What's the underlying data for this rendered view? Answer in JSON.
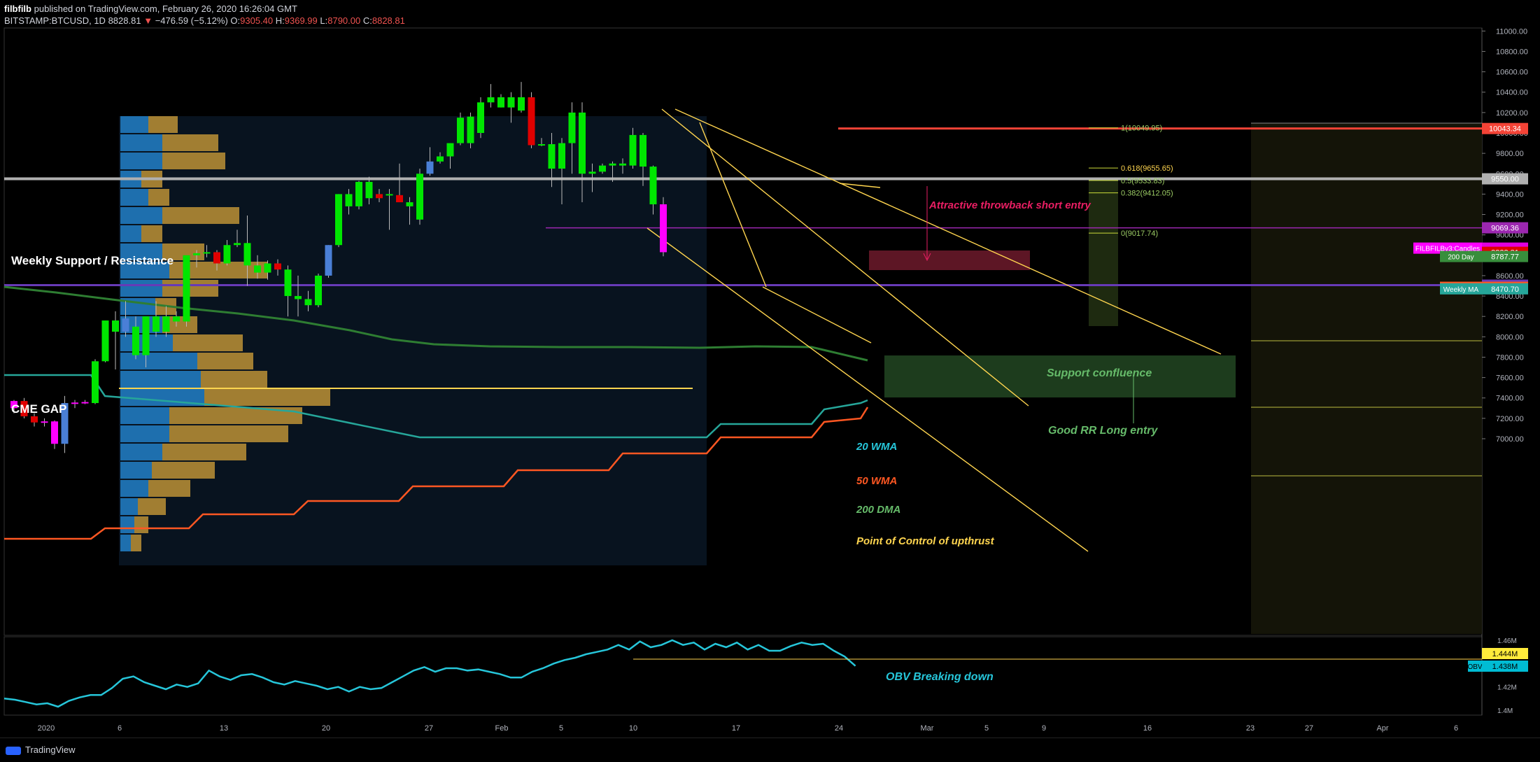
{
  "header": {
    "author": "filbfilb",
    "published": "published on TradingView.com, February 26, 2020 16:26:04 GMT",
    "symbol": "BITSTAMP:BTCUSD, 1D",
    "last": "8828.81",
    "change": "−476.59 (−5.12%)",
    "open_label": "O:",
    "open": "9305.40",
    "high_label": "H:",
    "high": "9369.99",
    "low_label": "L:",
    "low": "8790.00",
    "close_label": "C:",
    "close": "8828.81"
  },
  "footer": {
    "brand": "TradingView"
  },
  "colors": {
    "up": "#00e600",
    "down": "#e00000",
    "blue_candle": "#4a7fd6",
    "magenta_candle": "#ff00ff",
    "teal_line": "#26a69a",
    "orange_line": "#ff5722",
    "green_ma": "#2e7d32",
    "purple_line": "#673ab7",
    "white_line": "#b0b0b0",
    "yellow": "#ffd54f",
    "red_line": "#f44336",
    "obv": "#26c6da"
  },
  "chart_data": {
    "type": "candlestick",
    "y_axis": {
      "range": [
        6900,
        11100
      ],
      "ticks": [
        "11000.00",
        "10800.00",
        "10600.00",
        "10400.00",
        "10200.00",
        "10000.00",
        "9800.00",
        "9600.00",
        "9400.00",
        "9200.00",
        "9000.00",
        "8800.00",
        "8600.00",
        "8400.00",
        "8200.00",
        "8000.00",
        "7800.00",
        "7600.00",
        "7400.00",
        "7200.00",
        "7000.00"
      ]
    },
    "x_axis": {
      "ticks": [
        "2020",
        "6",
        "13",
        "20",
        "27",
        "Feb",
        "5",
        "10",
        "17",
        "24",
        "Mar",
        "5",
        "9",
        "16",
        "23",
        "27",
        "Apr",
        "6"
      ]
    },
    "price_labels": [
      {
        "text": "10043.34",
        "value": 10043.34,
        "color": "#f44336"
      },
      {
        "text": "9550.00",
        "value": 9550,
        "color": "#b0b0b0"
      },
      {
        "text": "9069.36",
        "value": 9069.36,
        "color": "#9c27b0"
      },
      {
        "text": "FILBFILBv3:Candles",
        "value": 8870,
        "color": "#ff00ff"
      },
      {
        "text": "8828.81",
        "value": 8828.81,
        "color": "#e00000"
      },
      {
        "text": "200 Day",
        "value": 8787.77,
        "color": "#388e3c",
        "value_text": "8787.77"
      },
      {
        "text": "8506.61",
        "value": 8506.61,
        "color": "#673ab7"
      },
      {
        "text": "Weekly MA",
        "value": 8485.73,
        "color": "#ff5722",
        "value_text": "8485.73"
      },
      {
        "text": "Weekly MA",
        "value": 8470.7,
        "color": "#26a69a",
        "value_text": "8470.70"
      }
    ],
    "fib_levels": [
      {
        "text": "1(10049.95)",
        "value": 10049.95
      },
      {
        "text": "0.618(9655.65)",
        "value": 9655.65
      },
      {
        "text": "0.5(9533.83)",
        "value": 9533.83
      },
      {
        "text": "0.382(9412.05)",
        "value": 9412.05
      },
      {
        "text": "0(9017.74)",
        "value": 9017.74
      }
    ],
    "annotations": [
      {
        "text": "Weekly Support / Resistance"
      },
      {
        "text": "CME GAP"
      },
      {
        "text": "Attractive throwback short entry"
      },
      {
        "text": "Support confluence"
      },
      {
        "text": "Good RR Long entry"
      },
      {
        "text": "20 WMA"
      },
      {
        "text": "50 WMA"
      },
      {
        "text": "200 DMA"
      },
      {
        "text": "Point of Control of upthrust"
      },
      {
        "text": "OBV Breaking down"
      }
    ],
    "candles": [
      {
        "o": 7300,
        "h": 7380,
        "l": 7250,
        "c": 7370
      },
      {
        "o": 7370,
        "h": 7400,
        "l": 7200,
        "c": 7220
      },
      {
        "o": 7220,
        "h": 7250,
        "l": 7120,
        "c": 7160
      },
      {
        "o": 7160,
        "h": 7200,
        "l": 7120,
        "c": 7170
      },
      {
        "o": 7170,
        "h": 7180,
        "l": 6900,
        "c": 6950
      },
      {
        "o": 6950,
        "h": 7420,
        "l": 6860,
        "c": 7350
      },
      {
        "o": 7350,
        "h": 7380,
        "l": 7300,
        "c": 7355
      },
      {
        "o": 7355,
        "h": 7380,
        "l": 7340,
        "c": 7360
      },
      {
        "o": 7350,
        "h": 7780,
        "l": 7340,
        "c": 7760
      },
      {
        "o": 7760,
        "h": 8100,
        "l": 7750,
        "c": 8160
      },
      {
        "o": 8160,
        "h": 8250,
        "l": 7680,
        "c": 8050
      },
      {
        "o": 8050,
        "h": 8350,
        "l": 8000,
        "c": 8180
      },
      {
        "o": 8100,
        "h": 8200,
        "l": 7780,
        "c": 7820
      },
      {
        "o": 7820,
        "h": 8150,
        "l": 7700,
        "c": 8200
      },
      {
        "o": 8200,
        "h": 8350,
        "l": 8000,
        "c": 8050
      },
      {
        "o": 8050,
        "h": 8300,
        "l": 8000,
        "c": 8200
      },
      {
        "o": 8200,
        "h": 8250,
        "l": 8100,
        "c": 8150
      },
      {
        "o": 8150,
        "h": 8650,
        "l": 8100,
        "c": 8800
      },
      {
        "o": 8800,
        "h": 8850,
        "l": 8680,
        "c": 8820
      },
      {
        "o": 8820,
        "h": 8900,
        "l": 8780,
        "c": 8830
      },
      {
        "o": 8830,
        "h": 8850,
        "l": 8650,
        "c": 8720
      },
      {
        "o": 8720,
        "h": 8950,
        "l": 8700,
        "c": 8900
      },
      {
        "o": 8900,
        "h": 9050,
        "l": 8880,
        "c": 8920
      },
      {
        "o": 8920,
        "h": 9190,
        "l": 8500,
        "c": 8700
      },
      {
        "o": 8700,
        "h": 8800,
        "l": 8570,
        "c": 8630
      },
      {
        "o": 8630,
        "h": 8750,
        "l": 8560,
        "c": 8720
      },
      {
        "o": 8720,
        "h": 8760,
        "l": 8600,
        "c": 8660
      },
      {
        "o": 8660,
        "h": 8700,
        "l": 8200,
        "c": 8400
      },
      {
        "o": 8400,
        "h": 8600,
        "l": 8200,
        "c": 8370
      },
      {
        "o": 8370,
        "h": 8450,
        "l": 8250,
        "c": 8310
      },
      {
        "o": 8310,
        "h": 8620,
        "l": 8290,
        "c": 8600
      },
      {
        "o": 8600,
        "h": 8900,
        "l": 8580,
        "c": 8900
      },
      {
        "o": 8900,
        "h": 9400,
        "l": 8880,
        "c": 9400
      },
      {
        "o": 9400,
        "h": 9450,
        "l": 9200,
        "c": 9280
      },
      {
        "o": 9280,
        "h": 9530,
        "l": 9250,
        "c": 9520
      },
      {
        "o": 9520,
        "h": 9570,
        "l": 9300,
        "c": 9360
      },
      {
        "o": 9360,
        "h": 9450,
        "l": 9320,
        "c": 9400
      },
      {
        "o": 9400,
        "h": 9450,
        "l": 9050,
        "c": 9390
      },
      {
        "o": 9390,
        "h": 9700,
        "l": 9380,
        "c": 9320
      },
      {
        "o": 9320,
        "h": 9370,
        "l": 9100,
        "c": 9280
      },
      {
        "o": 9150,
        "h": 9650,
        "l": 9100,
        "c": 9600
      },
      {
        "o": 9600,
        "h": 9860,
        "l": 9580,
        "c": 9720
      },
      {
        "o": 9720,
        "h": 9810,
        "l": 9700,
        "c": 9770
      },
      {
        "o": 9770,
        "h": 9900,
        "l": 9650,
        "c": 9900
      },
      {
        "o": 9900,
        "h": 10200,
        "l": 9880,
        "c": 10150
      },
      {
        "o": 9900,
        "h": 10200,
        "l": 9850,
        "c": 10160
      },
      {
        "o": 10000,
        "h": 10350,
        "l": 9950,
        "c": 10300
      },
      {
        "o": 10300,
        "h": 10480,
        "l": 10250,
        "c": 10350
      },
      {
        "o": 10350,
        "h": 10380,
        "l": 10250,
        "c": 10250
      },
      {
        "o": 10250,
        "h": 10400,
        "l": 10100,
        "c": 10350
      },
      {
        "o": 10350,
        "h": 10500,
        "l": 10200,
        "c": 10220
      },
      {
        "o": 10350,
        "h": 10400,
        "l": 9850,
        "c": 9880
      },
      {
        "o": 9880,
        "h": 9950,
        "l": 9870,
        "c": 9890
      },
      {
        "o": 9890,
        "h": 10000,
        "l": 9470,
        "c": 9650
      },
      {
        "o": 9650,
        "h": 9950,
        "l": 9300,
        "c": 9900
      },
      {
        "o": 9900,
        "h": 10300,
        "l": 9600,
        "c": 10200
      },
      {
        "o": 10200,
        "h": 10300,
        "l": 9320,
        "c": 9600
      },
      {
        "o": 9600,
        "h": 9700,
        "l": 9420,
        "c": 9620
      },
      {
        "o": 9620,
        "h": 9700,
        "l": 9600,
        "c": 9680
      },
      {
        "o": 9680,
        "h": 9720,
        "l": 9520,
        "c": 9700
      },
      {
        "o": 9700,
        "h": 9750,
        "l": 9600,
        "c": 9680
      },
      {
        "o": 9680,
        "h": 10050,
        "l": 9650,
        "c": 9980
      },
      {
        "o": 9980,
        "h": 10000,
        "l": 9480,
        "c": 9670
      },
      {
        "o": 9670,
        "h": 9680,
        "l": 9200,
        "c": 9300
      },
      {
        "o": 9300,
        "h": 9370,
        "l": 8790,
        "c": 8830
      }
    ],
    "candle_colors": [
      "magenta",
      "down",
      "down",
      "magenta",
      "magenta",
      "blue",
      "magenta",
      "magenta",
      "up",
      "up",
      "up",
      "blue",
      "up",
      "up",
      "up",
      "up",
      "up",
      "up",
      "up",
      "up",
      "down",
      "up",
      "up",
      "up",
      "up",
      "up",
      "down",
      "up",
      "up",
      "up",
      "up",
      "blue",
      "up",
      "up",
      "up",
      "up",
      "down",
      "up",
      "down",
      "up",
      "up",
      "blue",
      "up",
      "up",
      "up",
      "up",
      "up",
      "up",
      "up",
      "up",
      "up",
      "down",
      "up",
      "up",
      "up",
      "up",
      "up",
      "up",
      "up",
      "up",
      "up",
      "up",
      "up",
      "up",
      "magenta"
    ],
    "obv_axis": {
      "ticks": [
        "1.46M",
        "1.44M",
        "1.42M",
        "1.4M"
      ],
      "labels": [
        {
          "text": "1.444M"
        },
        {
          "text": "OBV",
          "value_text": "1.438M"
        }
      ]
    },
    "obv": [
      1.41,
      1.409,
      1.407,
      1.405,
      1.406,
      1.403,
      1.408,
      1.411,
      1.413,
      1.413,
      1.419,
      1.427,
      1.429,
      1.424,
      1.421,
      1.418,
      1.422,
      1.42,
      1.423,
      1.434,
      1.429,
      1.426,
      1.43,
      1.431,
      1.428,
      1.424,
      1.422,
      1.425,
      1.423,
      1.421,
      1.418,
      1.42,
      1.416,
      1.42,
      1.418,
      1.419,
      1.424,
      1.429,
      1.434,
      1.437,
      1.433,
      1.436,
      1.436,
      1.434,
      1.435,
      1.433,
      1.431,
      1.428,
      1.428,
      1.433,
      1.436,
      1.44,
      1.443,
      1.445,
      1.448,
      1.45,
      1.452,
      1.456,
      1.452,
      1.459,
      1.454,
      1.456,
      1.46,
      1.456,
      1.458,
      1.452,
      1.457,
      1.454,
      1.458,
      1.452,
      1.456,
      1.451,
      1.451,
      1.455,
      1.458,
      1.456,
      1.457,
      1.451,
      1.446,
      1.438
    ]
  }
}
